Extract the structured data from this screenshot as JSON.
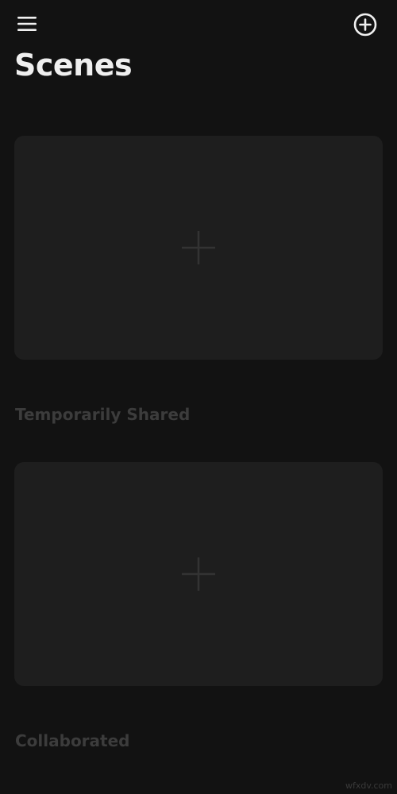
{
  "header": {
    "menu_icon": "hamburger-menu-icon",
    "add_icon": "plus-circle-icon",
    "title": "Scenes"
  },
  "sections": {
    "temporarily_shared": "Temporarily Shared",
    "collaborated": "Collaborated"
  },
  "cards": [
    {
      "icon": "plus-icon"
    },
    {
      "icon": "plus-icon"
    }
  ],
  "watermark": "wfxdv.com",
  "colors": {
    "background": "#121212",
    "card": "#1e1e1e",
    "title": "#efefef",
    "section_heading": "#3c3c3c",
    "card_plus": "#333333"
  }
}
